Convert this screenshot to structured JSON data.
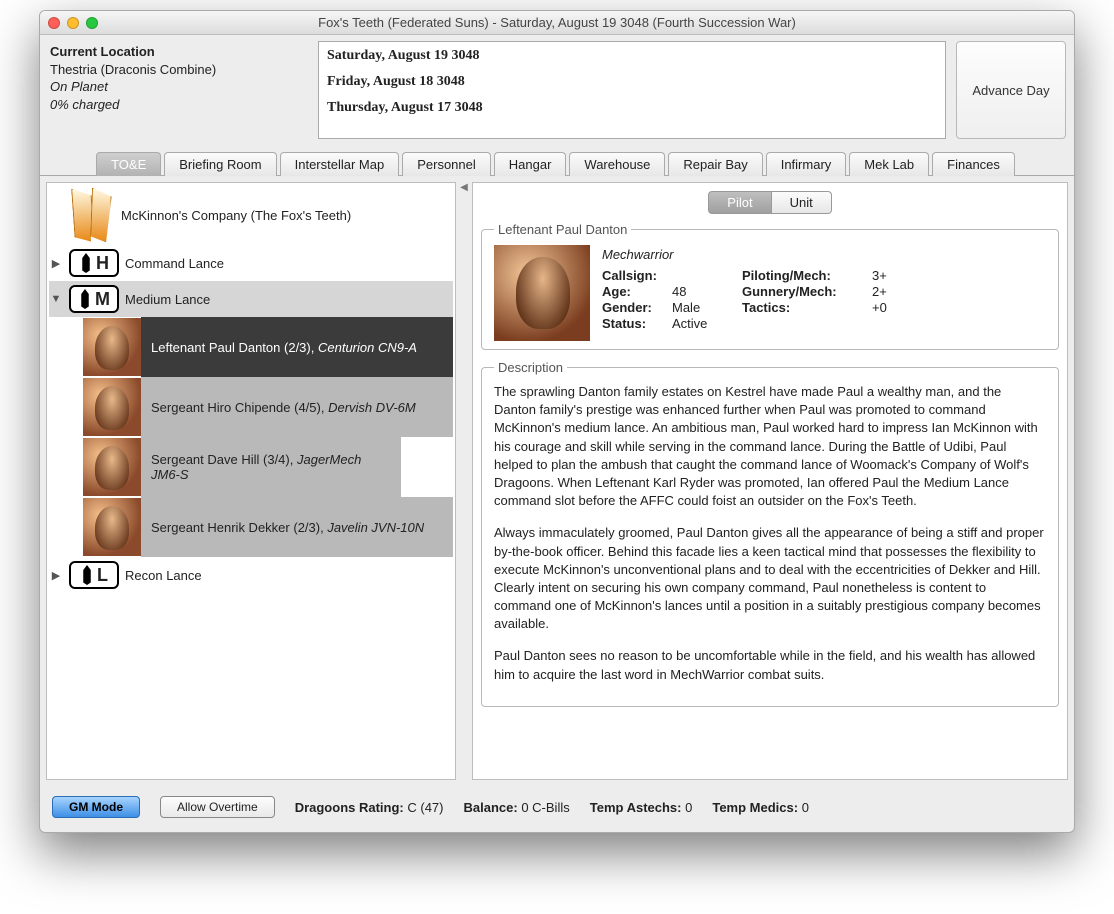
{
  "window_title": "Fox's Teeth (Federated Suns) - Saturday, August 19 3048 (Fourth Succession War)",
  "location": {
    "heading": "Current Location",
    "name": "Thestria (Draconis Combine)",
    "status": "On Planet",
    "charge": "0% charged"
  },
  "log": {
    "entries": [
      "Saturday, August 19 3048",
      "Friday, August 18 3048",
      "Thursday, August 17 3048"
    ]
  },
  "advance_label": "Advance Day",
  "tabs": [
    "TO&E",
    "Briefing Room",
    "Interstellar Map",
    "Personnel",
    "Hangar",
    "Warehouse",
    "Repair Bay",
    "Infirmary",
    "Mek Lab",
    "Finances"
  ],
  "tabs_active": "TO&E",
  "tree": {
    "company": "McKinnon's Company (The Fox's Teeth)",
    "lances": [
      {
        "letter": "H",
        "name": "Command Lance",
        "expanded": false
      },
      {
        "letter": "M",
        "name": "Medium Lance",
        "expanded": true,
        "pilots": [
          {
            "name": "Leftenant Paul Danton",
            "ratio": "(2/3)",
            "mech": "Centurion CN9-A",
            "selected": true
          },
          {
            "name": "Sergeant Hiro Chipende",
            "ratio": "(4/5)",
            "mech": "Dervish DV-6M",
            "selected": false
          },
          {
            "name": "Sergeant Dave Hill",
            "ratio": "(3/4)",
            "mech": "JagerMech JM6-S",
            "selected": false
          },
          {
            "name": "Sergeant Henrik Dekker",
            "ratio": "(2/3)",
            "mech": "Javelin JVN-10N",
            "selected": false
          }
        ]
      },
      {
        "letter": "L",
        "name": "Recon Lance",
        "expanded": false
      }
    ]
  },
  "detail_tabs": {
    "pilot": "Pilot",
    "unit": "Unit",
    "active": "Pilot"
  },
  "pilot": {
    "name": "Leftenant Paul Danton",
    "role": "Mechwarrior",
    "callsign_label": "Callsign:",
    "callsign": "",
    "age_label": "Age:",
    "age": "48",
    "gender_label": "Gender:",
    "gender": "Male",
    "status_label": "Status:",
    "status": "Active",
    "piloting_label": "Piloting/Mech:",
    "piloting": "3+",
    "gunnery_label": "Gunnery/Mech:",
    "gunnery": "2+",
    "tactics_label": "Tactics:",
    "tactics": "+0"
  },
  "description_heading": "Description",
  "description": {
    "p1": "The sprawling Danton family estates on Kestrel have made Paul a wealthy man, and the Danton family's prestige was enhanced further when Paul was promoted to command McKinnon's medium lance. An ambitious man, Paul worked hard to impress Ian McKinnon with his courage and skill while serving in the command lance. During the Battle of Udibi, Paul helped to plan the ambush that caught the command lance of Woomack's Company of Wolf's Dragoons. When Leftenant Karl Ryder was promoted, Ian offered Paul the Medium Lance command slot before the AFFC could foist an outsider on the Fox's Teeth.",
    "p2": "Always immaculately groomed, Paul Danton gives all the appearance of being a stiff and proper by-the-book officer. Behind this facade lies a keen tactical mind that possesses the flexibility to execute McKinnon's unconventional plans and to deal with the eccentricities of Dekker and Hill. Clearly intent on securing his own company command, Paul nonetheless is content to command one of McKinnon's lances until a position in a suitably prestigious company becomes available.",
    "p3": "Paul Danton sees no reason to be uncomfortable while in the field, and his wealth has allowed him to acquire the last word in MechWarrior combat suits."
  },
  "footer": {
    "gm_mode": "GM Mode",
    "overtime": "Allow Overtime",
    "dragoons_label": "Dragoons Rating:",
    "dragoons_value": "C (47)",
    "balance_label": "Balance:",
    "balance_value": "0 C-Bills",
    "astechs_label": "Temp Astechs:",
    "astechs_value": "0",
    "medics_label": "Temp Medics:",
    "medics_value": "0"
  }
}
